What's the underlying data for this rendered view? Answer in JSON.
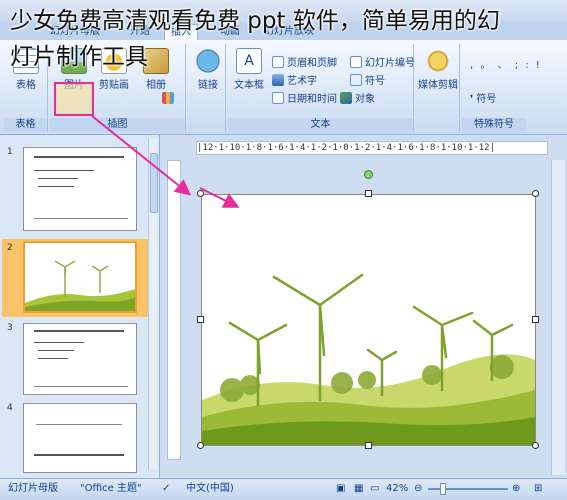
{
  "overlay": {
    "line1": "少女免费高清观看免费 ppt 软件，简单易用的幻",
    "line2": "灯片制作工具"
  },
  "tabs": [
    "幻灯片母版",
    "开始",
    "插入",
    "动画",
    "幻灯片放映"
  ],
  "ribbon": {
    "table_group": {
      "button": "表格",
      "label": "表格"
    },
    "illustrations_group": {
      "picture": "图片",
      "clipart": "剪贴画",
      "album": "相册",
      "label": "插图"
    },
    "links_group": {
      "button": "链接"
    },
    "text_group": {
      "textbox": "文本框",
      "header_footer": "页眉和页脚",
      "wordart": "艺术字",
      "datetime": "日期和时间",
      "slide_number": "幻灯片编号",
      "symbol": "符号",
      "object": "对象",
      "label": "文本"
    },
    "media_group": {
      "button": "媒体剪辑"
    },
    "special_group": {
      "symbol_btn": "符号",
      "label": "特殊符号",
      "punct": ", 。 、  ; : !"
    }
  },
  "slides_panel": {
    "numbers": [
      "1",
      "2",
      "3",
      "4"
    ]
  },
  "ruler_h_text": "|12·1·10·1·8·1·6·1·4·1·2·1·0·1·2·1·4·1·6·1·8·1·10·1·12|",
  "statusbar": {
    "view": "幻灯片母版",
    "theme": "\"Office 主题\"",
    "lang": "中文(中国)",
    "zoom": "42%"
  },
  "colors": {
    "highlight_border": "#e62c9a",
    "selected_slide": "#f0a030",
    "arrow": "#e62c9a"
  }
}
